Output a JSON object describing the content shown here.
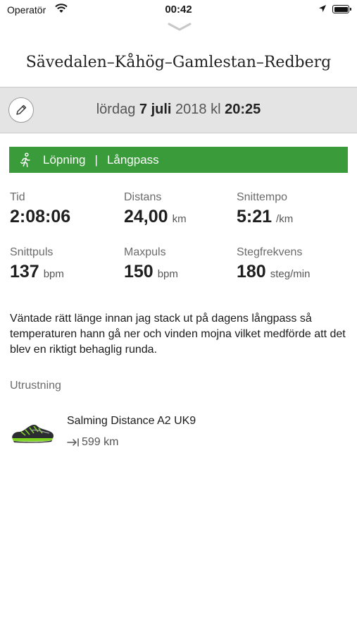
{
  "status_bar": {
    "carrier": "Operatör",
    "time": "00:42"
  },
  "title": "Sävedalen–Kåhög–Gamlestan–Redberg",
  "date": {
    "weekday": "lördag",
    "day_month": "7 juli",
    "year": "2018",
    "kl": "kl",
    "time": "20:25"
  },
  "activity": {
    "type": "Löpning",
    "separator": "|",
    "subtype": "Långpass",
    "color": "#3a9b3a",
    "icon": "running-icon"
  },
  "stats": {
    "tid": {
      "label": "Tid",
      "value": "2:08:06",
      "unit": ""
    },
    "distans": {
      "label": "Distans",
      "value": "24,00",
      "unit": "km"
    },
    "snittempo": {
      "label": "Snittempo",
      "value": "5:21",
      "unit": "/km"
    },
    "snittpuls": {
      "label": "Snittpuls",
      "value": "137",
      "unit": "bpm"
    },
    "maxpuls": {
      "label": "Maxpuls",
      "value": "150",
      "unit": "bpm"
    },
    "stegfrekvens": {
      "label": "Stegfrekvens",
      "value": "180",
      "unit": "steg/min"
    }
  },
  "notes": "Väntade rätt länge innan jag stack ut på dagens långpass så temperaturen hann gå ner och vinden mojna vilket medförde att det blev en riktigt behaglig runda.",
  "equipment": {
    "heading": "Utrustning",
    "item": {
      "name": "Salming Distance A2 UK9",
      "distance": "599 km",
      "icon": "shoe-image"
    }
  }
}
